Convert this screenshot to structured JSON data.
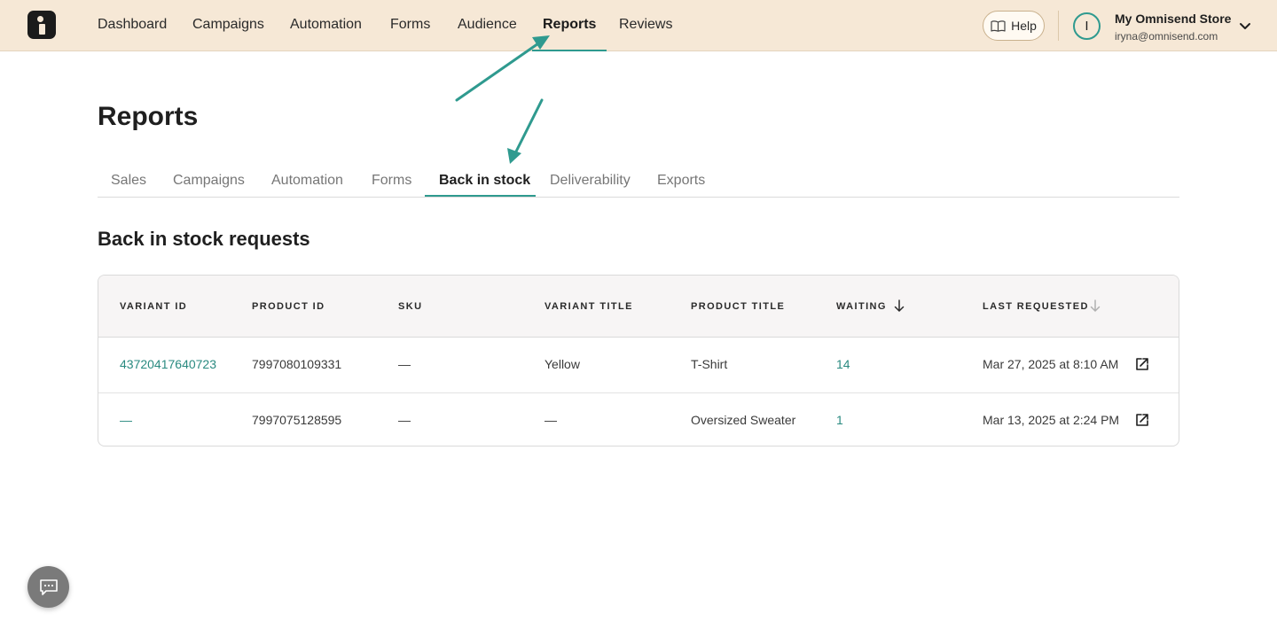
{
  "nav": {
    "items": [
      {
        "label": "Dashboard"
      },
      {
        "label": "Campaigns"
      },
      {
        "label": "Automation"
      },
      {
        "label": "Forms"
      },
      {
        "label": "Audience"
      },
      {
        "label": "Reports"
      },
      {
        "label": "Reviews"
      }
    ],
    "active": "Reports"
  },
  "header": {
    "help_label": "Help",
    "avatar_initial": "I",
    "store_name": "My Omnisend Store",
    "store_email": "iryna@omnisend.com"
  },
  "page": {
    "title": "Reports",
    "tabs": [
      {
        "label": "Sales"
      },
      {
        "label": "Campaigns"
      },
      {
        "label": "Automation"
      },
      {
        "label": "Forms"
      },
      {
        "label": "Back in stock"
      },
      {
        "label": "Deliverability"
      },
      {
        "label": "Exports"
      }
    ],
    "active_tab": "Back in stock",
    "section_title": "Back in stock requests"
  },
  "table": {
    "columns": [
      "VARIANT ID",
      "PRODUCT ID",
      "SKU",
      "VARIANT TITLE",
      "PRODUCT TITLE",
      "WAITING",
      "LAST REQUESTED"
    ],
    "rows": [
      {
        "variant_id": "43720417640723",
        "product_id": "7997080109331",
        "sku": "—",
        "variant_title": "Yellow",
        "product_title": "T-Shirt",
        "waiting": "14",
        "last_requested": "Mar 27, 2025 at 8:10 AM"
      },
      {
        "variant_id": "—",
        "product_id": "7997075128595",
        "sku": "—",
        "variant_title": "—",
        "product_title": "Oversized Sweater",
        "waiting": "1",
        "last_requested": "Mar 13, 2025 at 2:24 PM"
      }
    ]
  },
  "colors": {
    "accent": "#2f9a8f",
    "topbar_bg": "#f6e8d6",
    "link": "#2a8a80"
  },
  "icons": [
    "logo-icon",
    "book-icon",
    "chevron-down-icon",
    "sort-down-icon",
    "external-link-icon",
    "chat-icon",
    "annotation-arrow"
  ]
}
